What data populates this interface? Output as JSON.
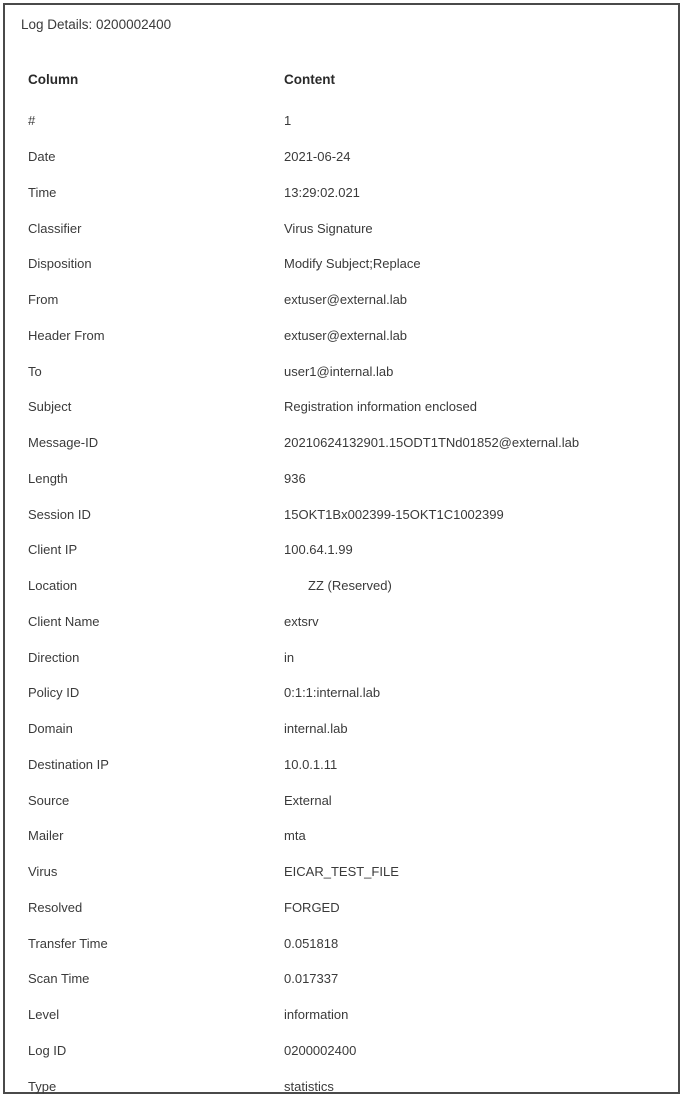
{
  "title": "Log Details: 0200002400",
  "headers": {
    "column": "Column",
    "content": "Content"
  },
  "rows": [
    {
      "column": "#",
      "content": "1"
    },
    {
      "column": "Date",
      "content": "2021-06-24"
    },
    {
      "column": "Time",
      "content": "13:29:02.021"
    },
    {
      "column": "Classifier",
      "content": "Virus Signature"
    },
    {
      "column": "Disposition",
      "content": "Modify Subject;Replace"
    },
    {
      "column": "From",
      "content": "extuser@external.lab"
    },
    {
      "column": "Header From",
      "content": "extuser@external.lab"
    },
    {
      "column": "To",
      "content": "user1@internal.lab"
    },
    {
      "column": "Subject",
      "content": "Registration information enclosed"
    },
    {
      "column": "Message-ID",
      "content": "20210624132901.15ODT1TNd01852@external.lab"
    },
    {
      "column": "Length",
      "content": "936"
    },
    {
      "column": "Session ID",
      "content": "15OKT1Bx002399-15OKT1C1002399"
    },
    {
      "column": "Client IP",
      "content": "100.64.1.99"
    },
    {
      "column": "Location",
      "content": "ZZ  (Reserved)"
    },
    {
      "column": "Client Name",
      "content": "extsrv"
    },
    {
      "column": "Direction",
      "content": "in"
    },
    {
      "column": "Policy ID",
      "content": "0:1:1:internal.lab"
    },
    {
      "column": "Domain",
      "content": "internal.lab"
    },
    {
      "column": "Destination IP",
      "content": "10.0.1.11"
    },
    {
      "column": "Source",
      "content": "External"
    },
    {
      "column": "Mailer",
      "content": "mta"
    },
    {
      "column": "Virus",
      "content": "EICAR_TEST_FILE"
    },
    {
      "column": "Resolved",
      "content": "FORGED"
    },
    {
      "column": "Transfer Time",
      "content": "0.051818"
    },
    {
      "column": "Scan Time",
      "content": "0.017337"
    },
    {
      "column": "Level",
      "content": "information"
    },
    {
      "column": "Log ID",
      "content": "0200002400"
    },
    {
      "column": "Type",
      "content": "statistics"
    }
  ]
}
